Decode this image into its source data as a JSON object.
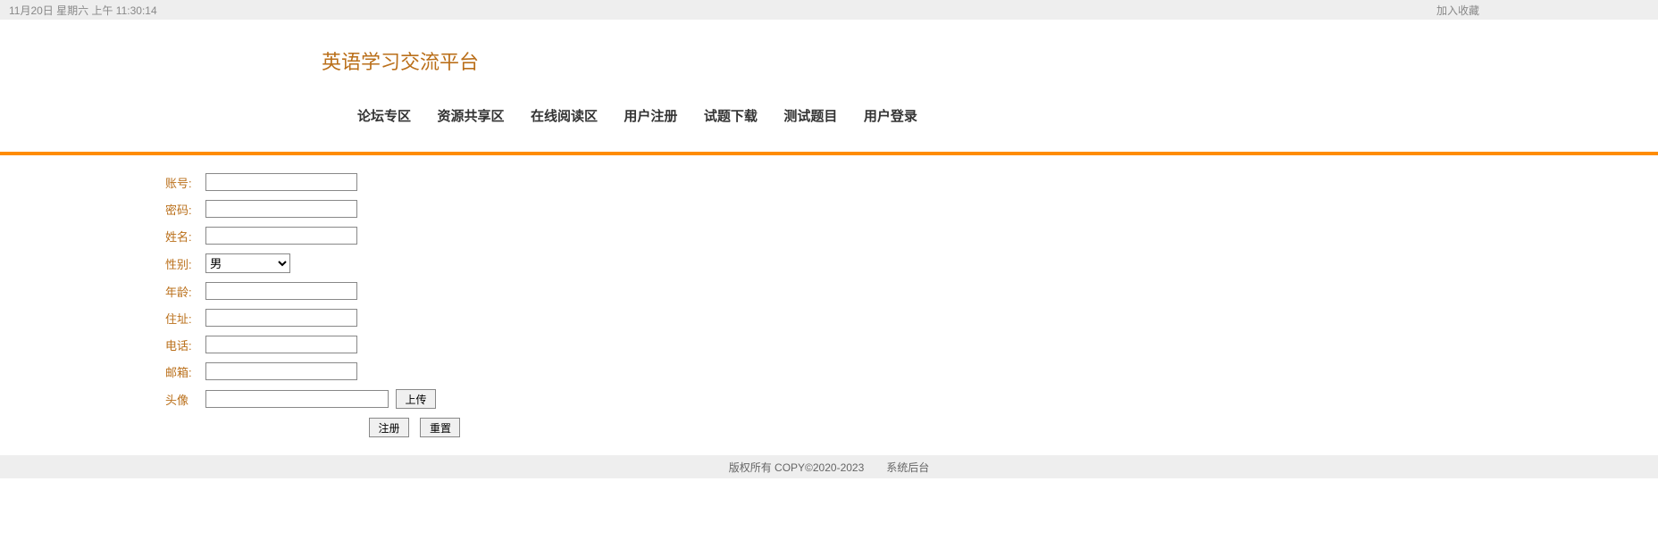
{
  "topBar": {
    "datetime": "11月20日 星期六 上午 11:30:14",
    "favorite": "加入收藏"
  },
  "header": {
    "title": "英语学习交流平台"
  },
  "nav": {
    "items": [
      {
        "label": "论坛专区"
      },
      {
        "label": "资源共享区"
      },
      {
        "label": "在线阅读区"
      },
      {
        "label": "用户注册"
      },
      {
        "label": "试题下载"
      },
      {
        "label": "测试题目"
      },
      {
        "label": "用户登录"
      }
    ]
  },
  "form": {
    "account": {
      "label": "账号:"
    },
    "password": {
      "label": "密码:"
    },
    "name": {
      "label": "姓名:"
    },
    "gender": {
      "label": "性别:",
      "selected": "男"
    },
    "age": {
      "label": "年龄:"
    },
    "address": {
      "label": "住址:"
    },
    "phone": {
      "label": "电话:"
    },
    "email": {
      "label": "邮箱:"
    },
    "avatar": {
      "label": "头像",
      "uploadBtn": "上传"
    },
    "registerBtn": "注册",
    "resetBtn": "重置"
  },
  "footer": {
    "copyright": "版权所有 COPY©2020-2023",
    "admin": "系统后台"
  }
}
